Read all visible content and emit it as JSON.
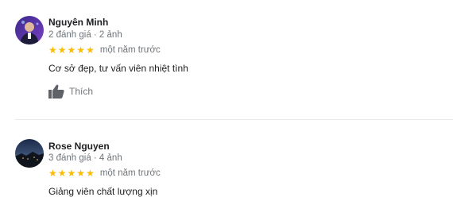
{
  "reviews": [
    {
      "author": "Nguyên Minh",
      "meta": "2 đánh giá · 2 ảnh",
      "stars": 5,
      "time": "một năm trước",
      "text": "Cơ sở đẹp, tư vấn viên nhiệt tình",
      "like_label": "Thích",
      "avatar_icon": "person-avatar"
    },
    {
      "author": "Rose Nguyen",
      "meta": "3 đánh giá · 4 ảnh",
      "stars": 5,
      "time": "một năm trước",
      "text": "Giảng viên chất lượng xịn",
      "avatar_icon": "landscape-avatar"
    }
  ],
  "colors": {
    "star": "#fbbc04",
    "meta_text": "#70757a",
    "divider": "#e8eaed"
  }
}
